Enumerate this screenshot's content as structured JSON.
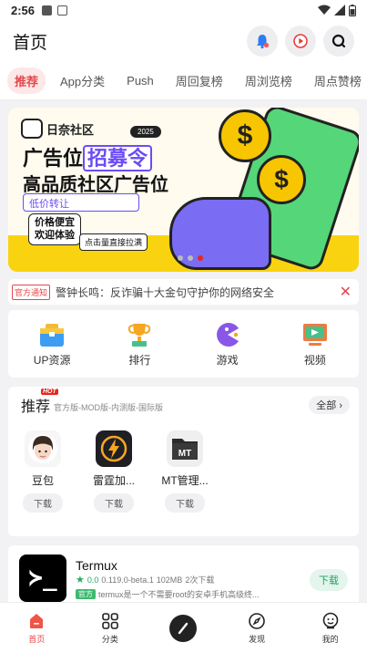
{
  "status_bar": {
    "time": "2:56"
  },
  "header": {
    "title": "首页"
  },
  "tabs": [
    {
      "label": "推荐",
      "active": true
    },
    {
      "label": "App分类"
    },
    {
      "label": "Push"
    },
    {
      "label": "周回复榜"
    },
    {
      "label": "周浏览榜"
    },
    {
      "label": "周点赞榜"
    }
  ],
  "banner": {
    "brand": "日奈社区",
    "year": "2025",
    "line1_a": "广告位",
    "line1_b": "招募令",
    "line2": "高品质社区广告位",
    "pill1": "低价转让",
    "pill2_a": "价格便宜",
    "pill2_b": "欢迎体验",
    "pill3": "点击量直接拉满",
    "coin_symbol": "$",
    "slides": 3,
    "active_slide": 3
  },
  "notice": {
    "tag": "官方通知",
    "text": "警钟长鸣：反诈骗十大金句守护你的网络安全",
    "close": "✕"
  },
  "quick_links": [
    {
      "label": "UP资源"
    },
    {
      "label": "排行"
    },
    {
      "label": "游戏"
    },
    {
      "label": "视频"
    }
  ],
  "recommend": {
    "title": "推荐",
    "hot": "HOT",
    "subtitle": "官方版-MOD版-内测版-国际版",
    "all_label": "全部",
    "apps": [
      {
        "name": "豆包",
        "download": "下载"
      },
      {
        "name": "雷霆加...",
        "download": "下载"
      },
      {
        "name": "MT管理...",
        "download": "下载",
        "icon_text": "MT"
      }
    ]
  },
  "featured_app": {
    "name": "Termux",
    "icon_text": "≻_",
    "rating": "0.0",
    "version": "0.119.0-beta.1",
    "size": "102MB",
    "downloads": "2次下载",
    "badge": "官方",
    "description": "termux是一个不需要root的安卓手机高级终...",
    "download": "下载"
  },
  "bottom_nav": [
    {
      "label": "首页",
      "active": true
    },
    {
      "label": "分类"
    },
    {
      "label": ""
    },
    {
      "label": "发现"
    },
    {
      "label": "我的"
    }
  ]
}
